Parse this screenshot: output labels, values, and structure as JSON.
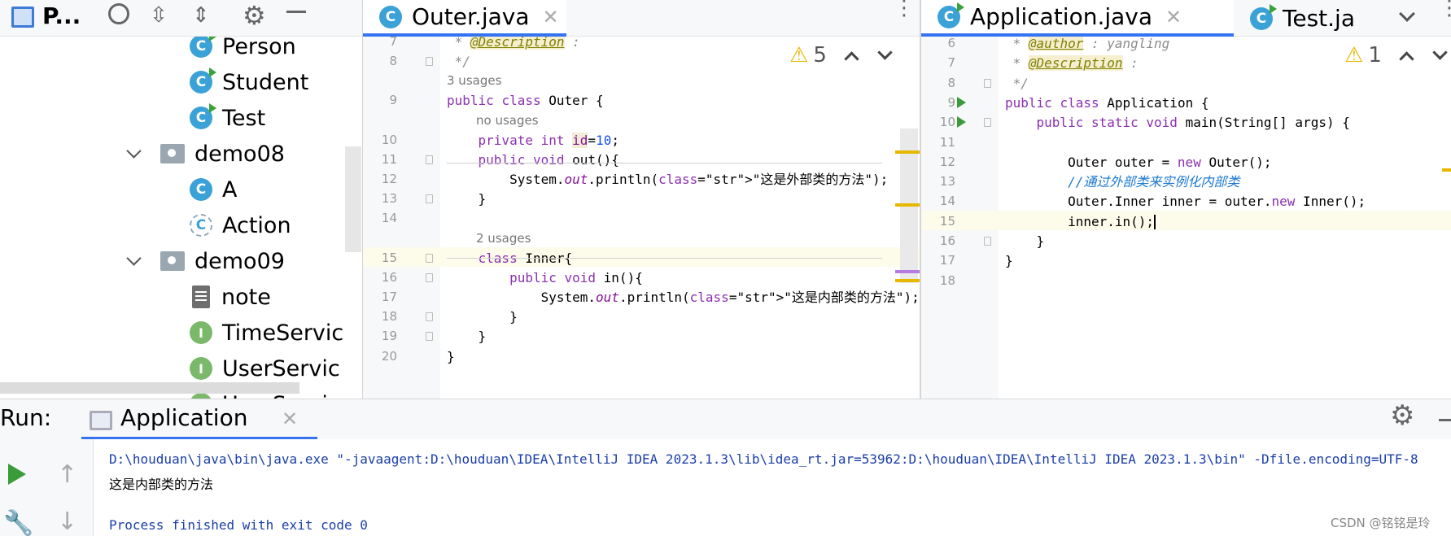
{
  "project": {
    "title": "P...",
    "tree": [
      {
        "label": "Person",
        "kind": "class-run"
      },
      {
        "label": "Student",
        "kind": "class-run"
      },
      {
        "label": "Test",
        "kind": "class-run"
      },
      {
        "label": "demo08",
        "kind": "package"
      },
      {
        "label": "A",
        "kind": "class"
      },
      {
        "label": "Action",
        "kind": "abstract-class"
      },
      {
        "label": "demo09",
        "kind": "package"
      },
      {
        "label": "note",
        "kind": "text-file"
      },
      {
        "label": "TimeServic",
        "kind": "interface"
      },
      {
        "label": "UserServic",
        "kind": "interface"
      },
      {
        "label": "UserServic",
        "kind": "interface"
      }
    ]
  },
  "editor_left": {
    "tab": {
      "label": "Outer.java",
      "icon": "C"
    },
    "warnings": "5",
    "lines": [
      {
        "n": "7",
        "code": " * @Description :"
      },
      {
        "n": "8",
        "code": " */"
      },
      {
        "hint": "3 usages"
      },
      {
        "n": "9",
        "code": "public class Outer {"
      },
      {
        "hint": "no usages"
      },
      {
        "n": "10",
        "code": "    private int id=10;"
      },
      {
        "n": "11",
        "code": "    public void out(){"
      },
      {
        "n": "12",
        "code": "        System.out.println(\"这是外部类的方法\");"
      },
      {
        "n": "13",
        "code": "    }"
      },
      {
        "n": "14",
        "code": ""
      },
      {
        "hint": "2 usages"
      },
      {
        "n": "15",
        "code": "    class Inner{"
      },
      {
        "n": "16",
        "code": "        public void in(){"
      },
      {
        "n": "17",
        "code": "            System.out.println(\"这是内部类的方法\");"
      },
      {
        "n": "18",
        "code": "        }"
      },
      {
        "n": "19",
        "code": "    }"
      },
      {
        "n": "20",
        "code": "}"
      }
    ]
  },
  "editor_right": {
    "tabs": [
      {
        "label": "Application.java",
        "icon": "C"
      },
      {
        "label": "Test.ja",
        "icon": "C"
      }
    ],
    "warnings": "1",
    "lines": [
      {
        "n": "6",
        "code": " * @author : yangling"
      },
      {
        "n": "7",
        "code": " * @Description :"
      },
      {
        "n": "8",
        "code": " */"
      },
      {
        "n": "9",
        "code": "public class Application {"
      },
      {
        "n": "10",
        "code": "    public static void main(String[] args) {"
      },
      {
        "n": "11",
        "code": ""
      },
      {
        "n": "12",
        "code": "        Outer outer = new Outer();"
      },
      {
        "n": "13",
        "code": "        //通过外部类来实例化内部类"
      },
      {
        "n": "14",
        "code": "        Outer.Inner inner = outer.new Inner();"
      },
      {
        "n": "15",
        "code": "        inner.in();"
      },
      {
        "n": "16",
        "code": "    }"
      },
      {
        "n": "17",
        "code": "}"
      },
      {
        "n": "18",
        "code": ""
      }
    ]
  },
  "run": {
    "label": "Run:",
    "tab": "Application",
    "console": [
      "D:\\houduan\\java\\bin\\java.exe \"-javaagent:D:\\houduan\\IDEA\\IntelliJ IDEA 2023.1.3\\lib\\idea_rt.jar=53962:D:\\houduan\\IDEA\\IntelliJ IDEA 2023.1.3\\bin\" -Dfile.encoding=UTF-8",
      "这是内部类的方法",
      "",
      "Process finished with exit code 0"
    ],
    "watermark": "CSDN @铭铭是玲"
  },
  "colors": {
    "accent": "#3574f0",
    "class_icon": "#3aa2d6",
    "run_green": "#3a9b3a",
    "warning": "#e6b800"
  }
}
